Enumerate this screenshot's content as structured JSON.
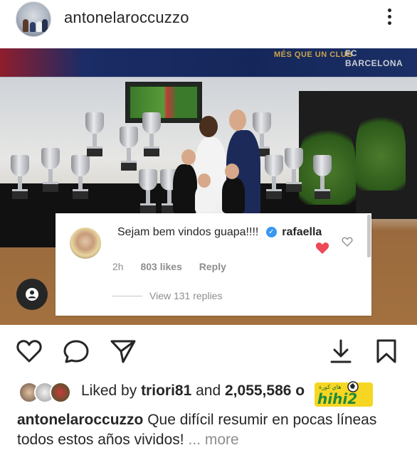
{
  "header": {
    "username": "antonelaroccuzzo",
    "more_icon": "more-vertical-icon"
  },
  "photo": {
    "banner_slogan": "MÉS QUE UN CLUB",
    "banner_brand": "FC BARCELONA"
  },
  "comment": {
    "text": "Sejam bem vindos guapa!!!!",
    "author": "rafaella",
    "verified_icon": "verified-badge-icon",
    "time": "2h",
    "likes": "803 likes",
    "reply_label": "Reply",
    "view_replies": "View 131 replies",
    "like_icon": "heart-outline-icon",
    "reaction_icon": "red-heart-icon"
  },
  "tag_button_icon": "user-tag-icon",
  "actions": {
    "like_icon": "heart-outline-icon",
    "comment_icon": "comment-bubble-icon",
    "share_icon": "paper-plane-icon",
    "download_icon": "download-icon",
    "save_icon": "bookmark-icon"
  },
  "likes": {
    "prefix": "Liked by",
    "user": "triori81",
    "middle": "and",
    "count": "2,055,586",
    "suffix": "o"
  },
  "caption": {
    "username": "antonelaroccuzzo",
    "text": "Que difícil resumir en pocas líneas todos estos años vividos!",
    "more_label": "... more"
  },
  "watermark": {
    "label": "هاي كورة",
    "logo_text": "hihi2"
  },
  "colors": {
    "accent_blue": "#3897f0",
    "heart_red": "#ed4956",
    "text": "#262626",
    "muted": "#8e8e8e"
  }
}
